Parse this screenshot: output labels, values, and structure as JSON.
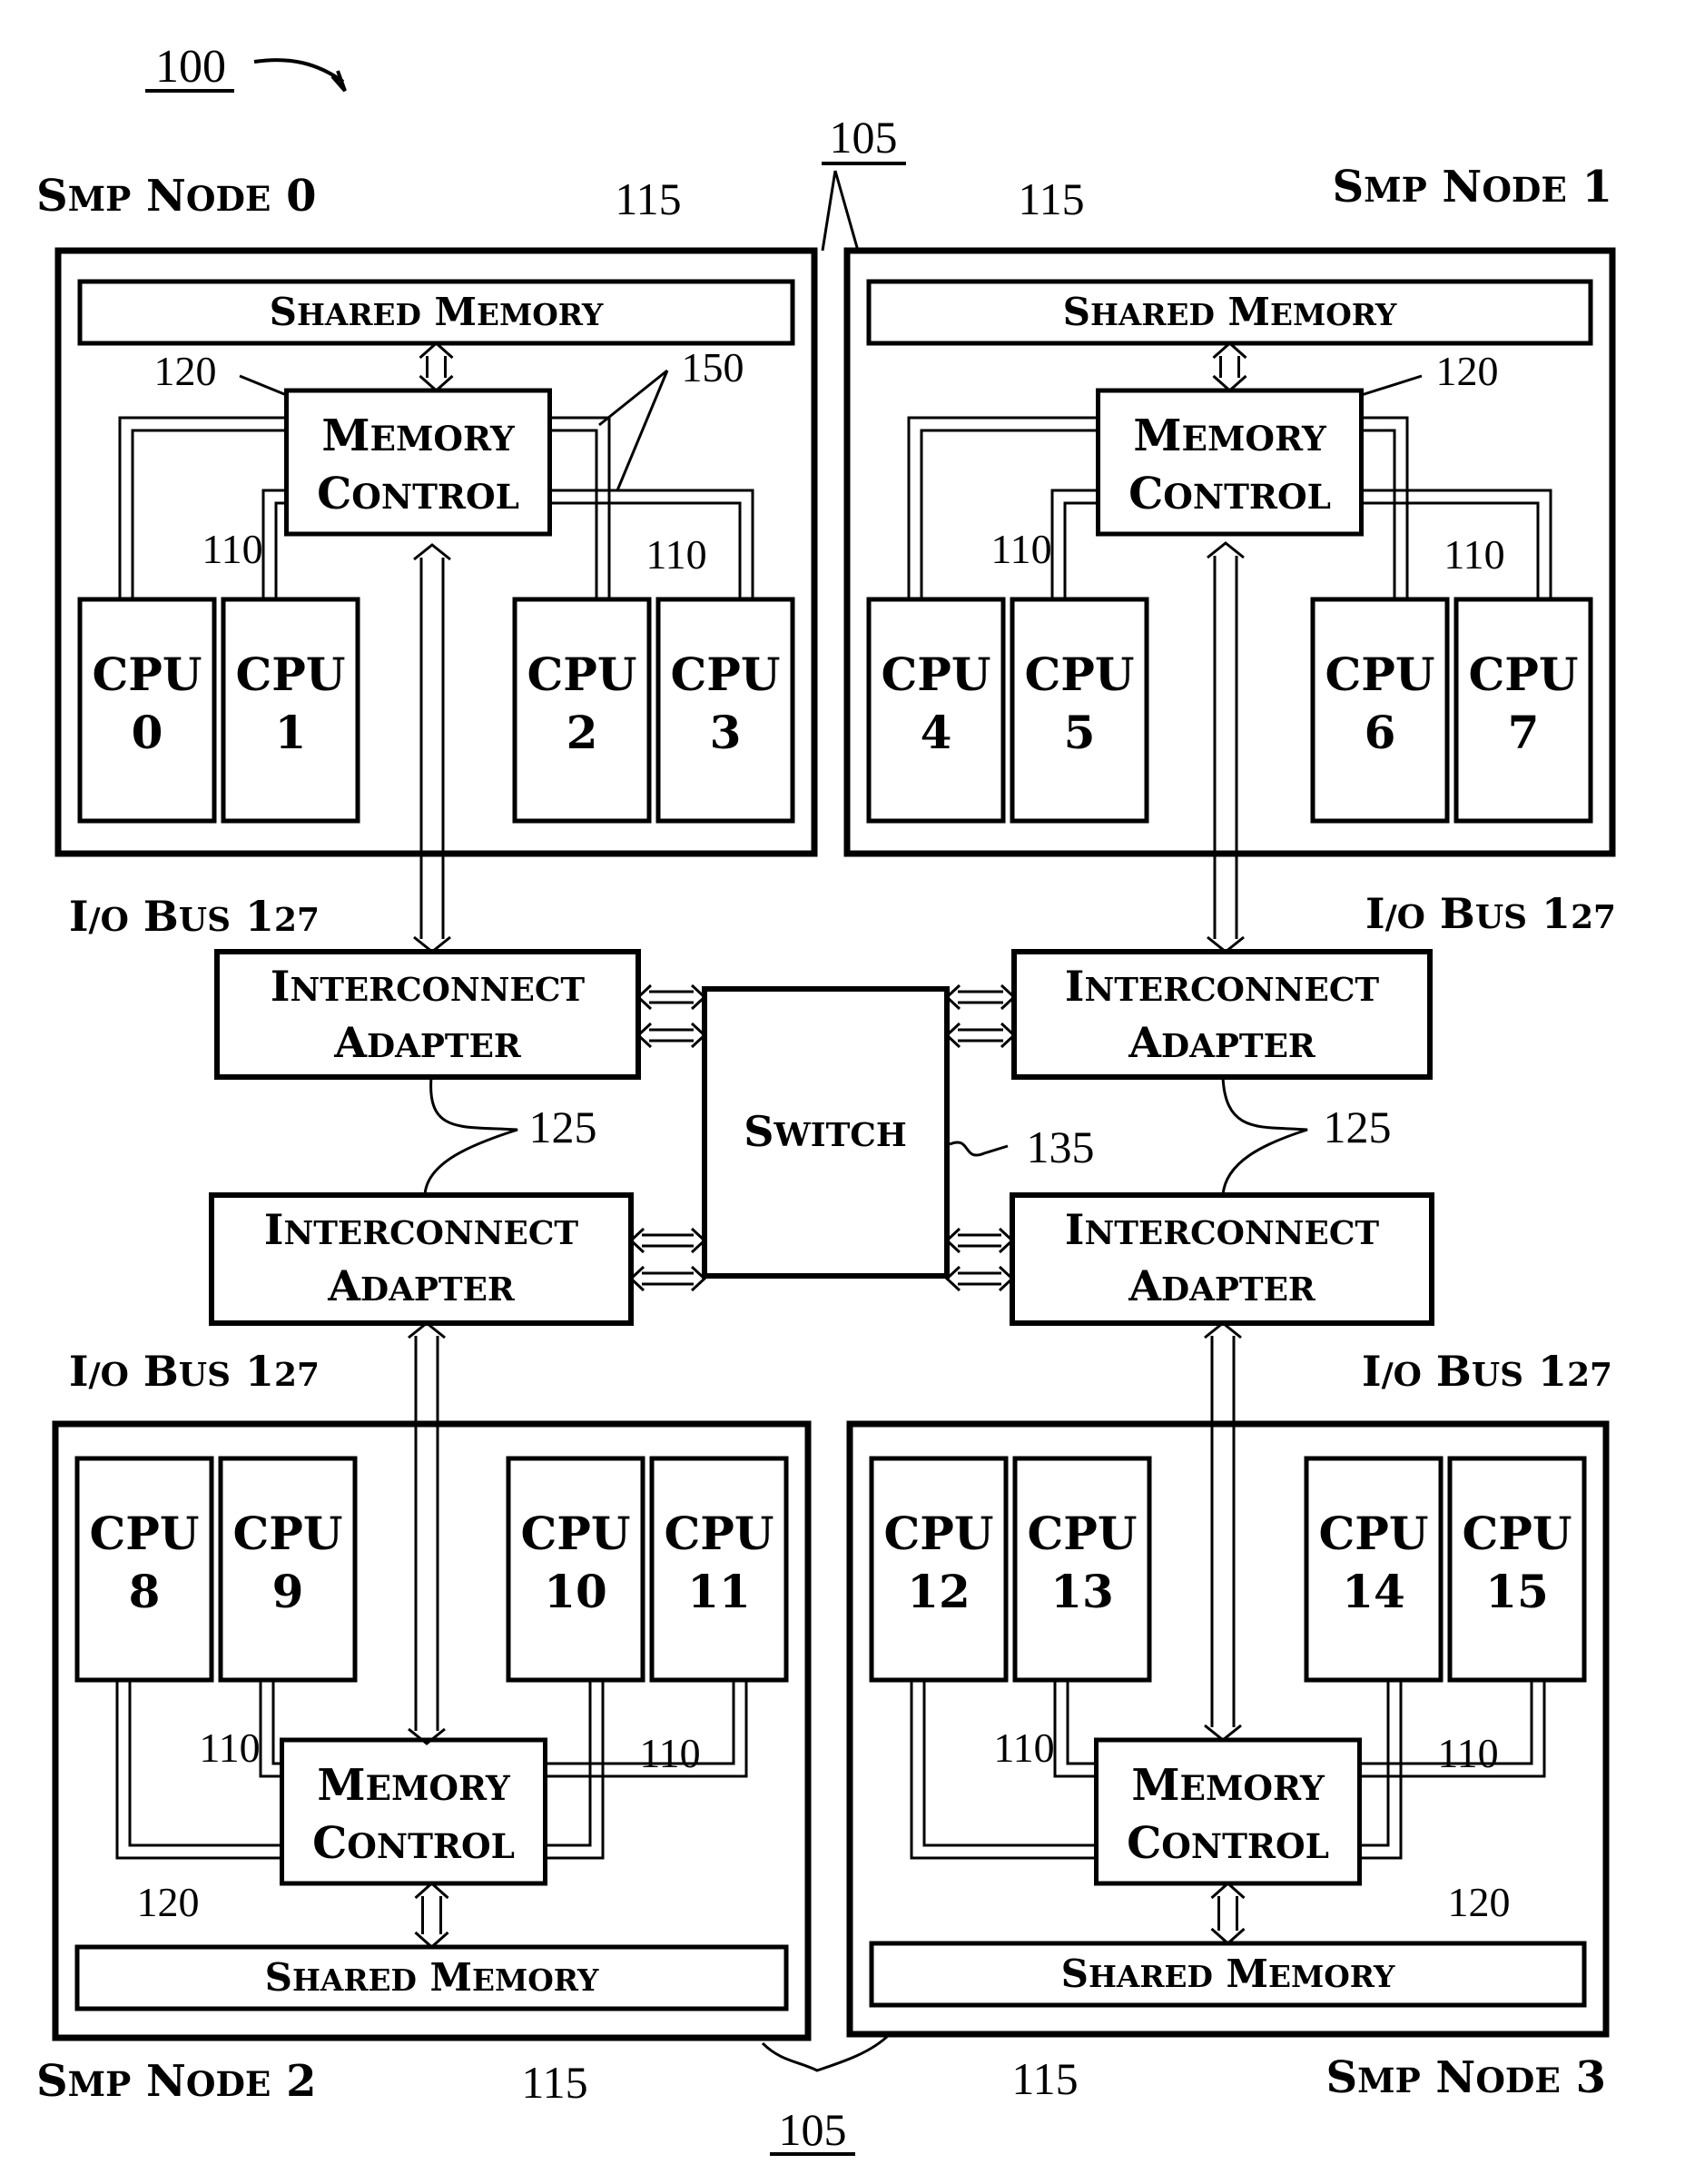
{
  "figure": {
    "ref": "100",
    "interconnect_ref_top": "105",
    "interconnect_ref_bottom": "105",
    "switch": {
      "label": "SWITCH",
      "ref": "135"
    },
    "adapter_pair_ref": "125",
    "io_bus_label": "I/O BUS 127",
    "adapter_label_line1": "INTERCONNECT",
    "adapter_label_line2": "ADAPTER"
  },
  "nodes": [
    {
      "name": "SMP NODE 0",
      "shared_memory": "SHARED MEMORY",
      "shared_memory_ref": "115",
      "memory_control_line1": "MEMORY",
      "memory_control_line2": "CONTROL",
      "memory_control_ref": "120",
      "port_ref": "150",
      "cpu_ref_left": "110",
      "cpu_ref_right": "110",
      "cpus": [
        "0",
        "1",
        "2",
        "3"
      ]
    },
    {
      "name": "SMP NODE 1",
      "shared_memory": "SHARED MEMORY",
      "shared_memory_ref": "115",
      "memory_control_line1": "MEMORY",
      "memory_control_line2": "CONTROL",
      "memory_control_ref": "120",
      "cpu_ref_left": "110",
      "cpu_ref_right": "110",
      "cpus": [
        "4",
        "5",
        "6",
        "7"
      ]
    },
    {
      "name": "SMP NODE 2",
      "shared_memory": "SHARED MEMORY",
      "shared_memory_ref": "115",
      "memory_control_line1": "MEMORY",
      "memory_control_line2": "CONTROL",
      "memory_control_ref": "120",
      "cpu_ref_left": "110",
      "cpu_ref_right": "110",
      "cpus": [
        "8",
        "9",
        "10",
        "11"
      ]
    },
    {
      "name": "SMP NODE 3",
      "shared_memory": "SHARED MEMORY",
      "shared_memory_ref": "115",
      "memory_control_line1": "MEMORY",
      "memory_control_line2": "CONTROL",
      "memory_control_ref": "120",
      "cpu_ref_left": "110",
      "cpu_ref_right": "110",
      "cpus": [
        "12",
        "13",
        "14",
        "15"
      ]
    }
  ],
  "cpu_label": "CPU"
}
